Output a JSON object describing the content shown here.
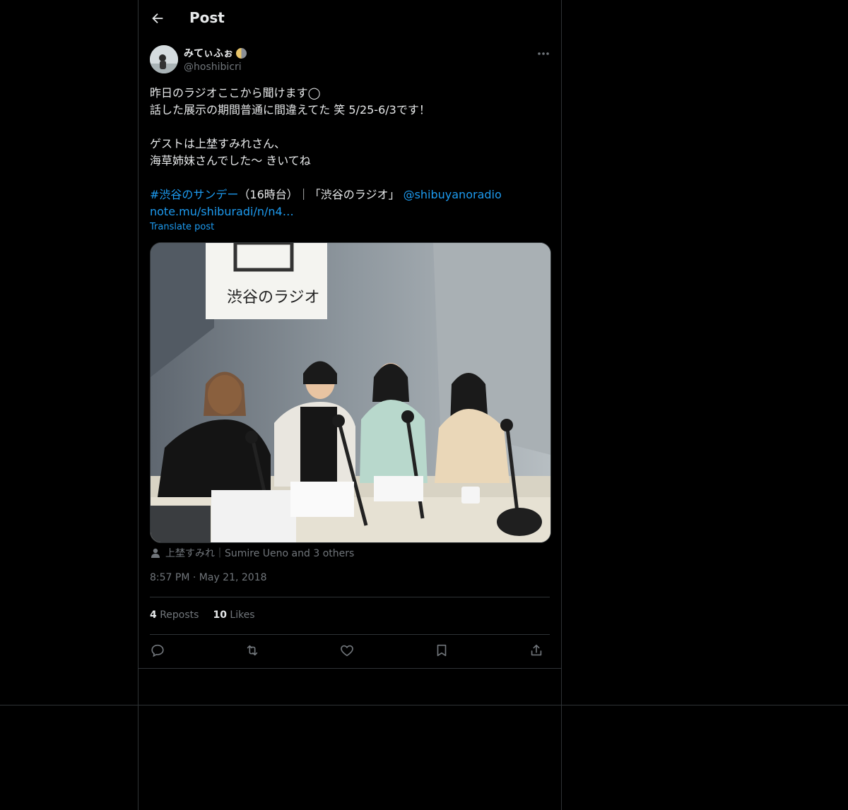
{
  "header": {
    "title": "Post",
    "back_icon": "arrow-left-icon"
  },
  "post": {
    "display_name": "みてぃふぉ",
    "name_emoji": "moon-icon",
    "handle": "@hoshibicri",
    "more_icon": "more-icon",
    "text_lines": [
      "昨日のラジオここから聞けます◯",
      "話した展示の期間普通に間違えてた 笑 5/25-6/3です！",
      "",
      "ゲストは上埜すみれさん、",
      "海草姉妹さんでした〜 きいてね"
    ],
    "hashtag": "#渋谷のサンデー",
    "after_hashtag": "（16時台）｜「渋谷のラジオ」",
    "mention": "@shibuyanoradio",
    "url": "note.mu/shiburadi/n/n4…",
    "translate_label": "Translate post",
    "photo_sign_text": "渋谷のラジオ",
    "tagged_people": "上埜すみれ｜Sumire Ueno and 3 others",
    "time": "8:57 PM",
    "date": "May 21, 2018",
    "date_separator": "·",
    "reposts_count": "4",
    "reposts_label": "Reposts",
    "likes_count": "10",
    "likes_label": "Likes"
  },
  "actions": [
    "reply-icon",
    "repost-icon",
    "like-icon",
    "bookmark-icon",
    "share-icon"
  ],
  "colors": {
    "background": "#000000",
    "text": "#e7e9ea",
    "muted": "#71767b",
    "accent": "#1d9bf0",
    "border": "#2f3336"
  }
}
